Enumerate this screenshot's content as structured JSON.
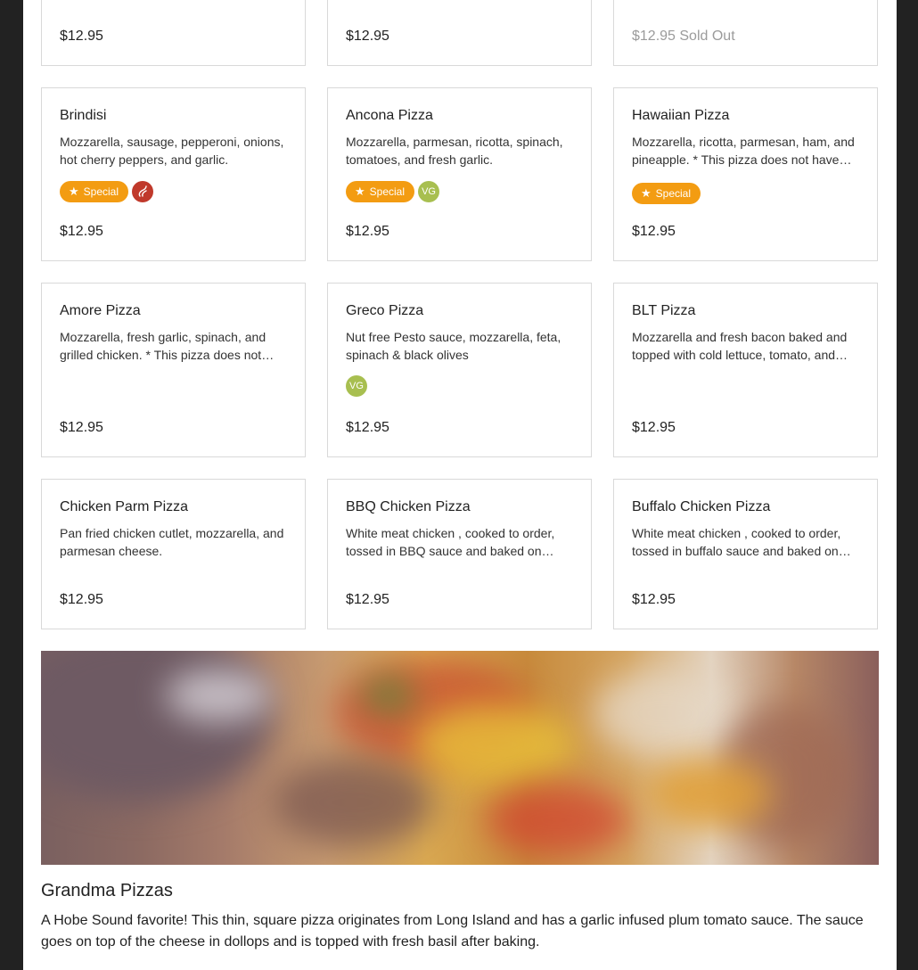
{
  "colors": {
    "special_badge": "#f39c12",
    "vegetarian_badge": "#a8bf50",
    "spicy_badge": "#c0392b",
    "sold_out_text": "#9b9b9b",
    "page_background": "#222222"
  },
  "top_row": [
    {
      "price": "$12.95",
      "badge": "vegetarian"
    },
    {
      "price": "$12.95",
      "badge": "special"
    },
    {
      "price": "$12.95 Sold Out",
      "badge": "special-gray",
      "sold_out": true
    }
  ],
  "items": [
    {
      "name": "Brindisi",
      "description": "Mozzarella, sausage, pepperoni, onions, hot cherry peppers, and garlic.",
      "special_label": "Special",
      "price": "$12.95"
    },
    {
      "name": "Ancona Pizza",
      "description": "Mozzarella, parmesan, ricotta, spinach, tomatoes, and fresh garlic.",
      "special_label": "Special",
      "vg_label": "VG",
      "price": "$12.95"
    },
    {
      "name": "Hawaiian Pizza",
      "description": "Mozzarella, ricotta, parmesan, ham, and pineapple. * This pizza does not have…",
      "special_label": "Special",
      "price": "$12.95"
    },
    {
      "name": "Amore Pizza",
      "description": "Mozzarella, fresh garlic, spinach, and grilled chicken. * This pizza does not…",
      "price": "$12.95"
    },
    {
      "name": "Greco Pizza",
      "description": "Nut free Pesto sauce, mozzarella, feta, spinach & black olives",
      "vg_label": "VG",
      "price": "$12.95"
    },
    {
      "name": "BLT Pizza",
      "description": "Mozzarella and fresh bacon baked and topped with cold lettuce, tomato, and…",
      "price": "$12.95"
    },
    {
      "name": "Chicken Parm Pizza",
      "description": "Pan fried chicken cutlet, mozzarella, and parmesan cheese.",
      "price": "$12.95"
    },
    {
      "name": "BBQ Chicken Pizza",
      "description": "White meat chicken , cooked to order, tossed in BBQ sauce and baked on…",
      "price": "$12.95"
    },
    {
      "name": "Buffalo Chicken Pizza",
      "description": "White meat chicken , cooked to order, tossed in buffalo sauce and baked on…",
      "price": "$12.95"
    }
  ],
  "section": {
    "title": "Grandma Pizzas",
    "description": "A Hobe Sound favorite! This thin, square pizza originates from Long Island and has a garlic infused plum tomato sauce. The sauce goes on top of the cheese in dollops and is topped with fresh basil after baking."
  }
}
